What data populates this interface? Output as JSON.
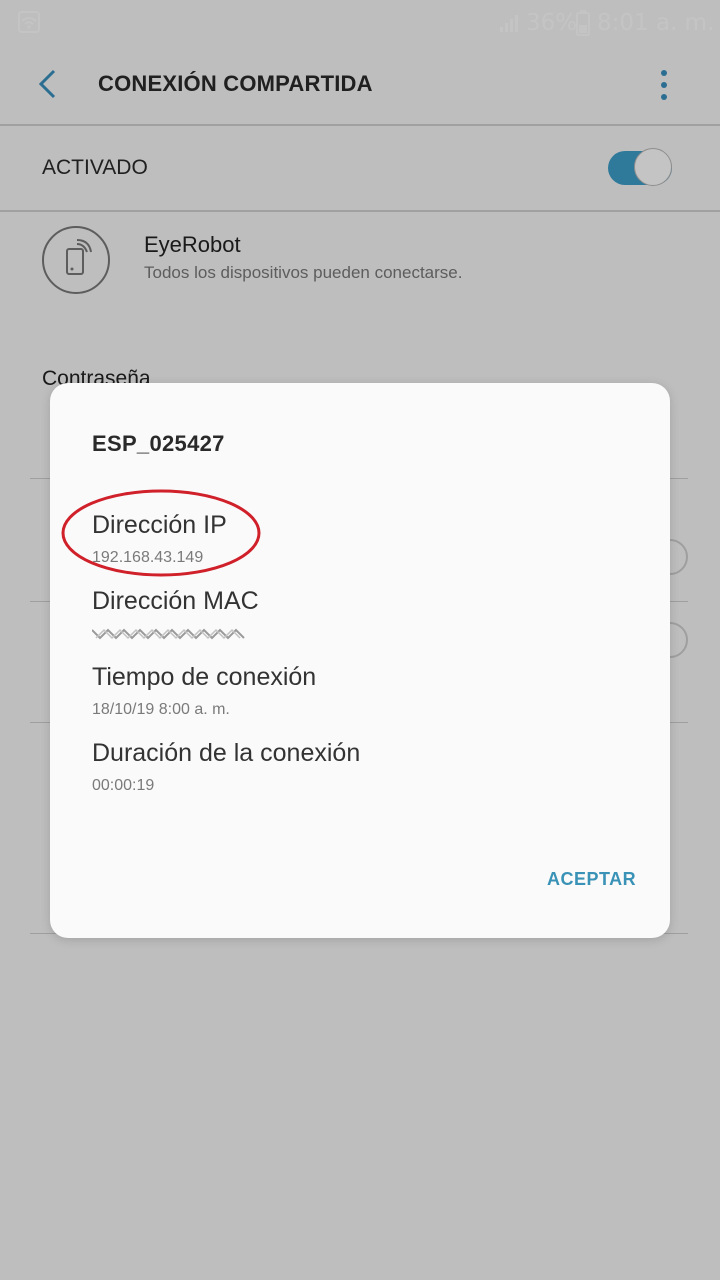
{
  "status_bar": {
    "battery_percent": "36%",
    "time": "8:01 a. m."
  },
  "app_bar": {
    "title": "CONEXIÓN COMPARTIDA"
  },
  "master_switch": {
    "label": "ACTIVADO",
    "enabled": true
  },
  "network": {
    "name": "EyeRobot",
    "subtitle": "Todos los dispositivos pueden conectarse."
  },
  "password": {
    "label": "Contraseña"
  },
  "dialog": {
    "title": "ESP_025427",
    "rows": [
      {
        "label": "Dirección IP",
        "value": "192.168.43.149"
      },
      {
        "label": "Dirección MAC",
        "value": ""
      },
      {
        "label": "Tiempo de conexión",
        "value": "18/10/19 8:00 a. m."
      },
      {
        "label": "Duración de la conexión",
        "value": "00:00:19"
      }
    ],
    "accept_label": "ACEPTAR"
  },
  "colors": {
    "accent": "#3e9ec9",
    "highlight_ellipse": "#d0202a",
    "scrim": "rgba(0,0,0,0.23)"
  }
}
